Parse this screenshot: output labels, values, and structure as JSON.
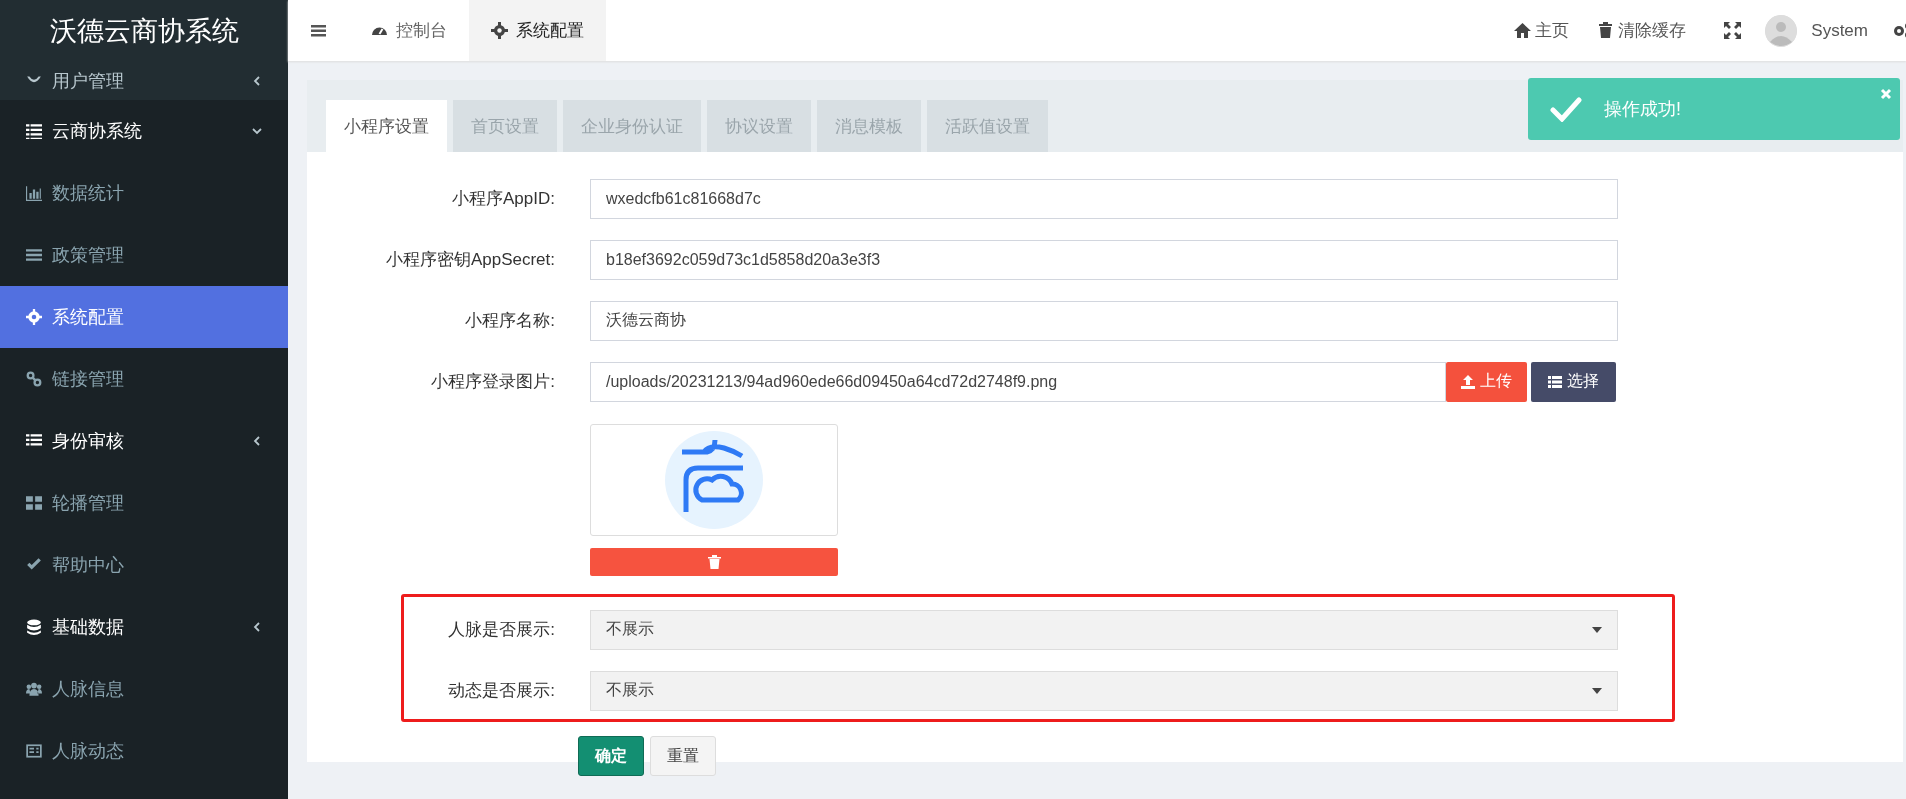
{
  "sidebar": {
    "title": "沃德云商协系统",
    "items": [
      {
        "label": "用户管理",
        "kind": "group",
        "expanded": false,
        "highlighted": true,
        "selected": false
      },
      {
        "label": "云商协系统",
        "kind": "group",
        "expanded": true,
        "highlighted": false,
        "selected": false
      },
      {
        "label": "数据统计",
        "kind": "item",
        "selected": false
      },
      {
        "label": "政策管理",
        "kind": "item",
        "selected": false
      },
      {
        "label": "系统配置",
        "kind": "item",
        "selected": true
      },
      {
        "label": "链接管理",
        "kind": "item",
        "selected": false
      },
      {
        "label": "身份审核",
        "kind": "group",
        "expanded": false,
        "highlighted": false,
        "selected": false
      },
      {
        "label": "轮播管理",
        "kind": "item",
        "selected": false
      },
      {
        "label": "帮助中心",
        "kind": "item",
        "selected": false
      },
      {
        "label": "基础数据",
        "kind": "group",
        "expanded": false,
        "highlighted": false,
        "selected": false
      },
      {
        "label": "人脉信息",
        "kind": "item",
        "selected": false
      },
      {
        "label": "人脉动态",
        "kind": "item",
        "selected": false
      }
    ]
  },
  "topbar": {
    "tabs": [
      {
        "label": "控制台",
        "selected": false
      },
      {
        "label": "系统配置",
        "selected": true
      }
    ],
    "actions": [
      {
        "label": "主页"
      },
      {
        "label": "清除缓存"
      }
    ],
    "user": "System"
  },
  "toast": {
    "message": "操作成功!"
  },
  "config_tabs": [
    {
      "label": "小程序设置",
      "selected": true
    },
    {
      "label": "首页设置",
      "selected": false
    },
    {
      "label": "企业身份认证",
      "selected": false
    },
    {
      "label": "协议设置",
      "selected": false
    },
    {
      "label": "消息模板",
      "selected": false
    },
    {
      "label": "活跃值设置",
      "selected": false
    }
  ],
  "fields": [
    {
      "label": "小程序AppID:",
      "value": "wxedcfb61c81668d7c"
    },
    {
      "label": "小程序密钥AppSecret:",
      "value": "b18ef3692c059d73c1d5858d20a3e3f3"
    },
    {
      "label": "小程序名称:",
      "value": "沃德云商协"
    },
    {
      "label": "小程序登录图片:",
      "value": "/uploads/20231213/94ad960ede66d09450a64cd72d2748f9.png",
      "upload_button": "上传",
      "choose_button": "选择"
    }
  ],
  "highlighted_selects": [
    {
      "label": "人脉是否展示:",
      "value": "不展示"
    },
    {
      "label": "动态是否展示:",
      "value": "不展示"
    }
  ],
  "buttons": [
    {
      "label": "确定",
      "kind": "primary"
    },
    {
      "label": "重置",
      "kind": "default"
    }
  ]
}
